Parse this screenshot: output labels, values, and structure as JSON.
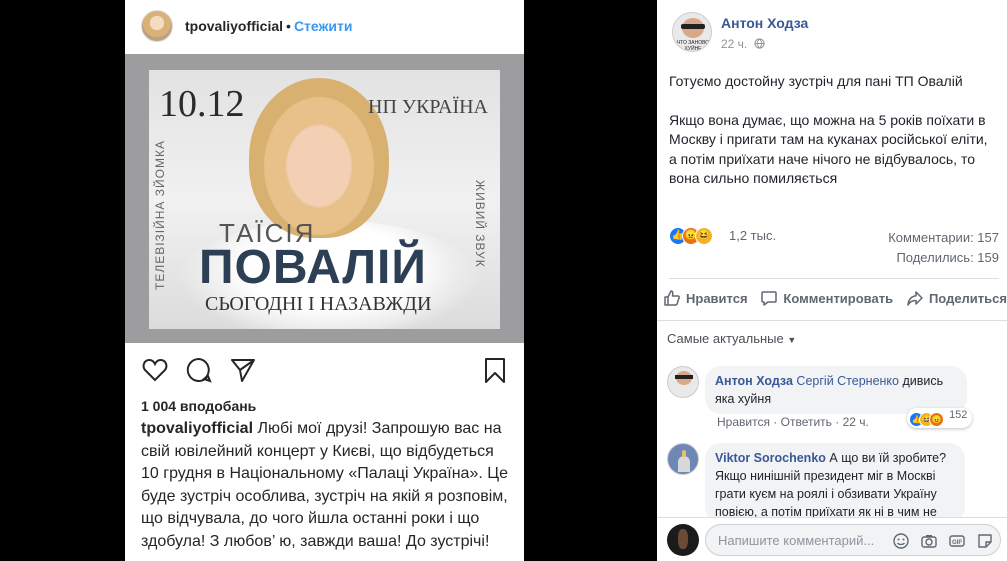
{
  "instagram": {
    "username": "tpovaliyofficial",
    "separator": "•",
    "follow_label": "Стежити",
    "poster": {
      "date": "10.12",
      "venue": "НП УКРАЇНА",
      "left_vertical": "ТЕЛЕВІЗІЙНА ЗЙОМКА",
      "right_vertical": "ЖИВИЙ ЗВУК",
      "first_name": "ТАЇСІЯ",
      "last_name": "ПОВАЛІЙ",
      "tagline": "СЬОГОДНІ І НАЗАВЖДИ"
    },
    "icons": [
      "heart-icon",
      "comment-icon",
      "share-icon",
      "bookmark-icon"
    ],
    "likes": "1 004 вподобань",
    "caption_user": "tpovaliyofficial",
    "caption_text": "Любі мої друзі! Запрошую вас на свій ювілейний концерт у Києві, що відбудеться 10 грудня в  Національному «Палаці Україна». Це буде зустріч особлива, зустріч на якій я розповім, що відчувала, до чого йшла останні роки і що здобула! З любов’ ю, завжди ваша! До зустрічі!"
  },
  "facebook": {
    "author": "Антон Ходза",
    "avatar_caption": "ЧТО ЗАНОВО ХУЙНЕ",
    "time": "22 ч.",
    "privacy_icon": "globe-icon",
    "post_p1": "Готуємо достойну зустріч для пані ТП Овалій",
    "post_p2": "Якщо вона думає, що можна на 5 років поїхати в Москву і пригати там на куканах російської еліти, а потім приїхати наче нічого не відбувалось, то вона сильно помиляється",
    "reactions_count": "1,2 тыс.",
    "comments_stat": "Комментарии: 157",
    "shares_stat": "Поделились: 159",
    "btn_like": "Нравится",
    "btn_comment": "Комментировать",
    "btn_share": "Поделиться",
    "sort_label": "Самые актуальные",
    "comments": [
      {
        "author": "Антон Ходза",
        "mention": "Сергій Стерненко",
        "text": "дивись яка хуйня",
        "like": "Нравится",
        "reply": "Ответить",
        "time": "22 ч.",
        "reaction_count": "152"
      },
      {
        "author": "Viktor Sorochenko",
        "text": "А що ви їй зробите? Якщо нинішній президент міг в Москві грати куєм на роялі і обзивати Україну повією, а потім приїхати як ні в чим не"
      }
    ],
    "input_placeholder": "Напишите комментарий...",
    "colors": {
      "link": "#385898",
      "like_blue": "#1877f2",
      "angry": "#e9710f",
      "haha": "#f7b125"
    }
  }
}
